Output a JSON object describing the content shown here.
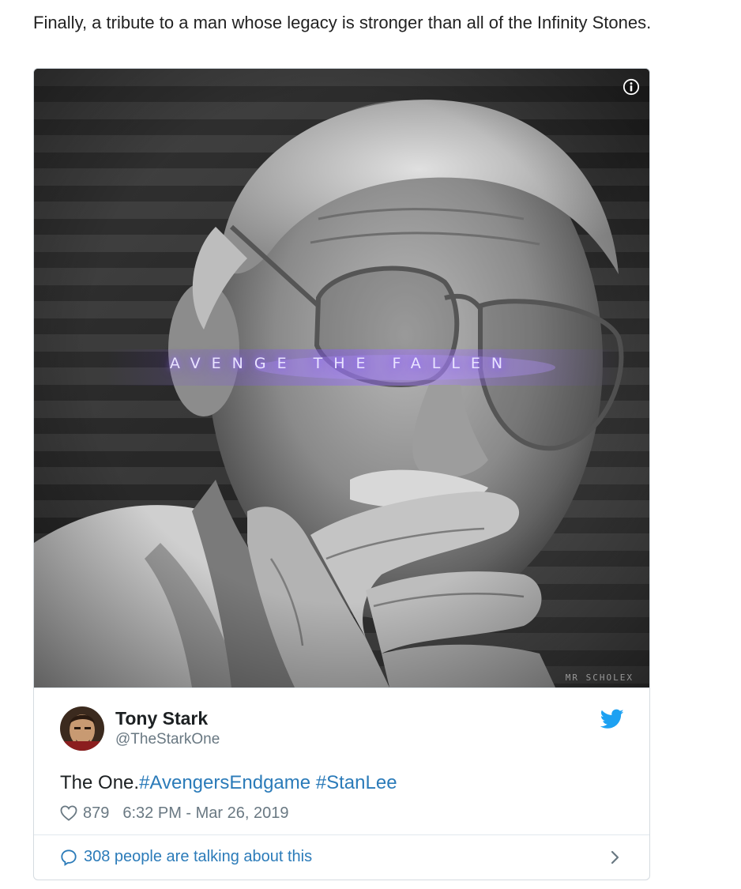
{
  "article": {
    "intro_text": "Finally, a tribute to a man whose legacy is stronger than all of the Infinity Stones."
  },
  "media": {
    "tagline": "AVENGE THE FALLEN",
    "watermark": "MR SCHOLEX",
    "info_icon": "info-icon"
  },
  "tweet": {
    "author_name": "Tony Stark",
    "author_handle": "@TheStarkOne",
    "text_plain": "The One.",
    "hashtags": [
      "#AvengersEndgame",
      "#StanLee"
    ],
    "likes": "879",
    "timestamp": "6:32 PM - Mar 26, 2019",
    "talking": "308 people are talking about this",
    "icons": {
      "brand": "twitter-bird-icon",
      "like": "heart-icon",
      "reply": "speech-bubble-icon",
      "more": "chevron-right-icon"
    }
  },
  "colors": {
    "link": "#2b7bb9",
    "twitter_blue": "#1da1f2",
    "muted": "#697882",
    "glow": "#8a5cff"
  }
}
